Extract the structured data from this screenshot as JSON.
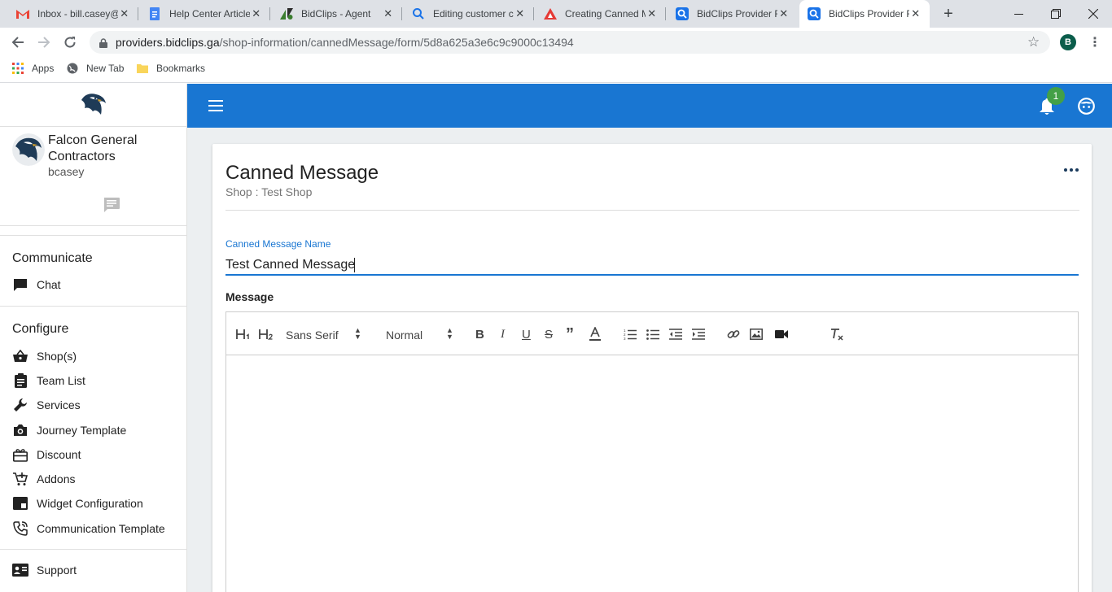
{
  "browser": {
    "tabs": [
      {
        "title": "Inbox - bill.casey@",
        "icon": "gmail-icon",
        "color": "#ea4335"
      },
      {
        "title": "Help Center Article",
        "icon": "docs-icon",
        "color": "#4285f4"
      },
      {
        "title": "BidClips - Agent",
        "icon": "zendesk-icon",
        "color": "#1f73b7"
      },
      {
        "title": "Editing customer c",
        "icon": "search-icon",
        "color": "#1a73e8"
      },
      {
        "title": "Creating Canned M",
        "icon": "delta-icon",
        "color": "#e53935"
      },
      {
        "title": "BidClips Provider F",
        "icon": "bidclips-icon",
        "color": "#1a73e8"
      },
      {
        "title": "BidClips Provider F",
        "icon": "bidclips-icon",
        "color": "#1a73e8"
      }
    ],
    "active_tab": 6,
    "url_host": "providers.bidclips.ga",
    "url_path": "/shop-information/cannedMessage/form/5d8a625a3e6c9c9000c13494",
    "profile_initial": "B",
    "bookmarks": [
      "Apps",
      "New Tab",
      "Bookmarks"
    ]
  },
  "sidebar": {
    "company": "Falcon General Contractors",
    "username": "bcasey",
    "sections": [
      {
        "title": "Communicate",
        "items": [
          {
            "label": "Chat",
            "icon": "chat-icon"
          }
        ]
      },
      {
        "title": "Configure",
        "items": [
          {
            "label": "Shop(s)",
            "icon": "basket-icon"
          },
          {
            "label": "Team List",
            "icon": "clipboard-icon"
          },
          {
            "label": "Services",
            "icon": "wrench-icon"
          },
          {
            "label": "Journey Template",
            "icon": "camera-icon"
          },
          {
            "label": "Discount",
            "icon": "gift-icon"
          },
          {
            "label": "Addons",
            "icon": "cart-plus-icon"
          },
          {
            "label": "Widget Configuration",
            "icon": "widget-icon"
          },
          {
            "label": "Communication Template",
            "icon": "phone-icon"
          }
        ]
      }
    ],
    "footer_item": {
      "label": "Support",
      "icon": "contact-card-icon"
    }
  },
  "appbar": {
    "notification_count": "1",
    "color": "#1976d2"
  },
  "page": {
    "title": "Canned Message",
    "subtitle": "Shop : Test Shop",
    "name_field": {
      "label": "Canned Message Name",
      "value": "Test Canned Message"
    },
    "message_label": "Message",
    "editor": {
      "font_select": "Sans Serif",
      "size_select": "Normal",
      "body": ""
    }
  }
}
